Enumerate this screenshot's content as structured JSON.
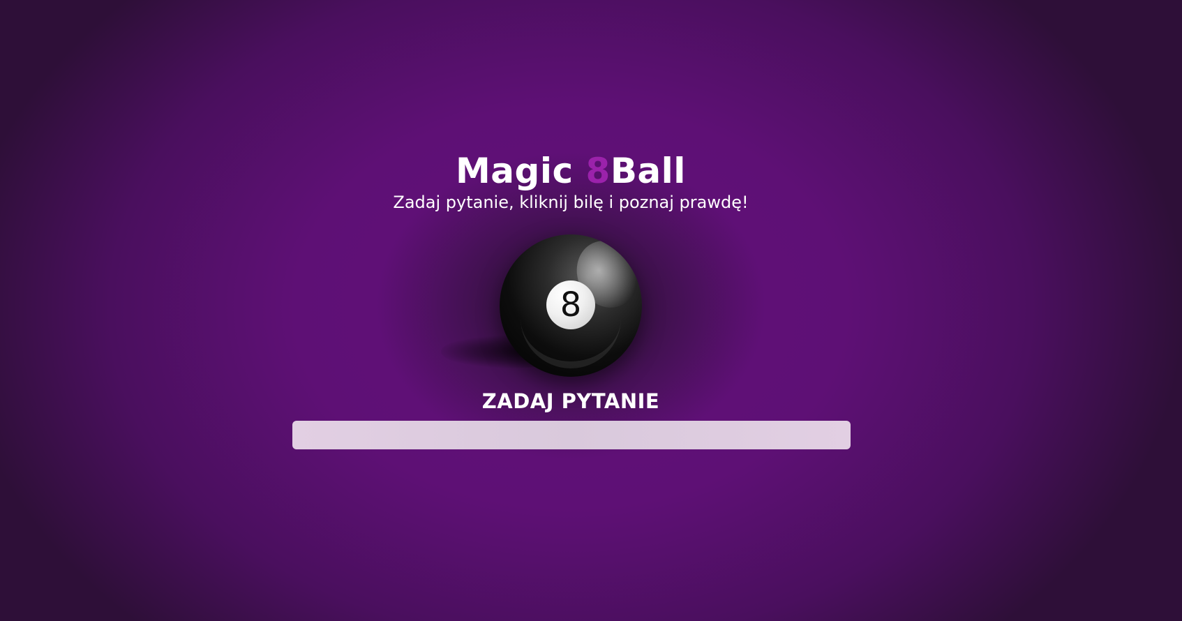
{
  "header": {
    "title_prefix": "Magic ",
    "title_accent": "8",
    "title_suffix": "Ball",
    "subtitle": "Zadaj pytanie, kliknij bilę i poznaj prawdę!"
  },
  "ball": {
    "number": "8"
  },
  "question": {
    "label": "ZADAJ PYTANIE",
    "value": "",
    "placeholder": ""
  },
  "colors": {
    "accent": "#9b22ab",
    "background_center": "#62107a",
    "background_edge": "#2e0f38",
    "input_background": "#e0cee2"
  }
}
